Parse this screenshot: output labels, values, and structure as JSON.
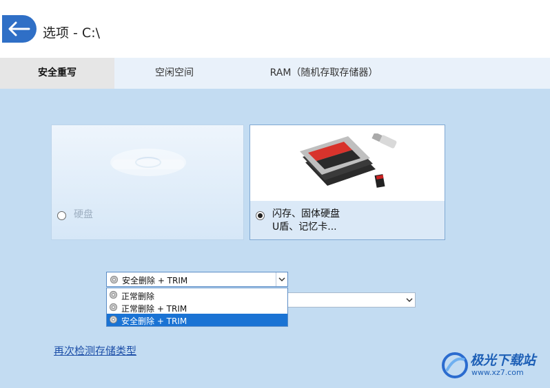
{
  "header": {
    "title": "选项 - C:\\",
    "back_icon": "arrow-left-icon"
  },
  "tabs": [
    {
      "label": "安全重写",
      "active": true
    },
    {
      "label": "空闲空间",
      "active": false
    },
    {
      "label": "RAM（随机存取存储器）",
      "active": false
    }
  ],
  "storage_types": {
    "hdd": {
      "label": "硬盘",
      "selected": false
    },
    "flash": {
      "line1": "闪存、固体硬盘",
      "line2": "U盾、记忆卡...",
      "selected": true
    }
  },
  "method_select": {
    "value": "安全删除 + TRIM",
    "options": [
      "正常删除",
      "正常删除 + TRIM",
      "安全删除 + TRIM"
    ],
    "selected_index": 2
  },
  "redetect_link": "再次检测存储类型",
  "watermark": {
    "text": "极光下载站",
    "url": "www.xz7.com"
  },
  "colors": {
    "accent": "#2f6fc6",
    "content_bg": "#c3dcf2",
    "tab_bg": "#e9f1fa",
    "selection": "#1a73d4"
  }
}
